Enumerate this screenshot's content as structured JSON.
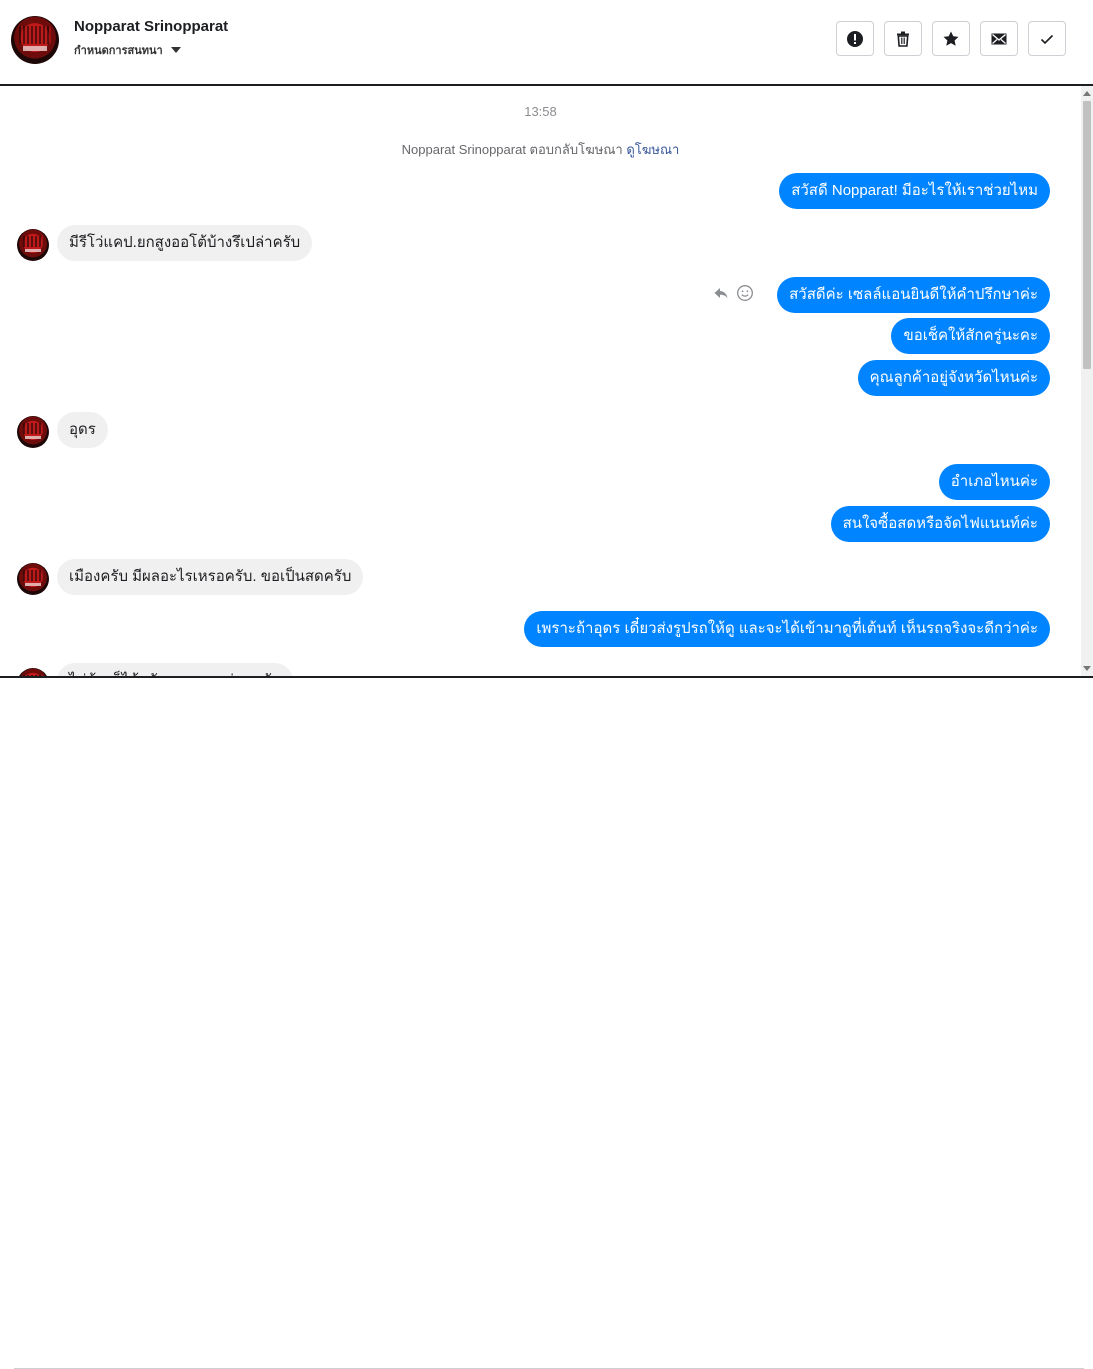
{
  "header": {
    "contact_name": "Nopparat Srinopparat",
    "subtitle": "กำหนดการสนทนา",
    "actions": [
      {
        "name": "mark-spam-button",
        "icon": "exclamation-circle-icon"
      },
      {
        "name": "delete-button",
        "icon": "trash-icon"
      },
      {
        "name": "star-button",
        "icon": "star-icon"
      },
      {
        "name": "mark-unread-button",
        "icon": "envelope-icon"
      },
      {
        "name": "mark-done-button",
        "icon": "checkmark-icon"
      }
    ]
  },
  "thread": {
    "timestamp": "13:58",
    "notice_text": "Nopparat Srinopparat ตอบกลับโฆษณา ",
    "notice_link": "ดูโฆษณา",
    "messages": [
      {
        "from": "page",
        "text": "สวัสดี Nopparat! มีอะไรให้เราช่วยไหม"
      },
      {
        "from": "user",
        "text": "มีรีโว่แคป.ยกสูงออโต้บ้างรึเปล่าครับ"
      },
      {
        "from": "page",
        "text": "สวัสดีค่ะ เซลล์แอนยินดีให้คำปรึกษาค่ะ"
      },
      {
        "from": "page",
        "text": "ขอเช็คให้สักครู่นะคะ"
      },
      {
        "from": "page",
        "text": "คุณลูกค้าอยู่จังหวัดไหนค่ะ"
      },
      {
        "from": "user",
        "text": "อุดร"
      },
      {
        "from": "page",
        "text": "อำเภอไหนค่ะ"
      },
      {
        "from": "page",
        "text": "สนใจซื้อสดหรือจัดไฟแนนท์ค่ะ"
      },
      {
        "from": "user",
        "text": "เมืองครับ มีผลอะไรเหรอครับ. ขอเป็นสดครับ"
      },
      {
        "from": "page",
        "text": "เพราะถ้าอุดร เดี๋ยวส่งรูปรถให้ดู และจะได้เข้ามาดูที่เต้นท์ เห็นรถจริงจะดีกว่าค่ะ"
      },
      {
        "from": "user",
        "text": "ไม่ต้องก็ได้ครับ ขอราคาก่อนครับ"
      }
    ]
  },
  "colors": {
    "outgoing_bubble": "#0084ff",
    "incoming_bubble": "#f1f0f0",
    "link": "#385898"
  }
}
